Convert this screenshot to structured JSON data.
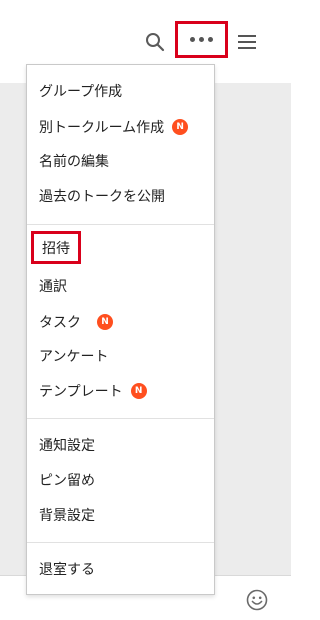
{
  "header": {
    "icons": [
      "search-icon",
      "more-horizontal-icon",
      "hamburger-menu-icon"
    ]
  },
  "menu": {
    "badge_text": "N",
    "badge_color": "#ff4f1f",
    "highlight_color": "#d9001b",
    "items": [
      {
        "label": "グループ作成",
        "badge": false
      },
      {
        "label": "別トークルーム作成",
        "badge": true
      },
      {
        "label": "名前の編集",
        "badge": false
      },
      {
        "label": "過去のトークを公開",
        "badge": false
      },
      {
        "label": "招待",
        "badge": false,
        "highlighted": true
      },
      {
        "label": "通訳",
        "badge": false
      },
      {
        "label": "タスク",
        "badge": true
      },
      {
        "label": "アンケート",
        "badge": false
      },
      {
        "label": "テンプレート",
        "badge": true
      },
      {
        "label": "通知設定",
        "badge": false
      },
      {
        "label": "ピン留め",
        "badge": false
      },
      {
        "label": "背景設定",
        "badge": false
      },
      {
        "label": "退室する",
        "badge": false
      }
    ]
  },
  "footer": {
    "icons": [
      "smiley-icon"
    ]
  }
}
